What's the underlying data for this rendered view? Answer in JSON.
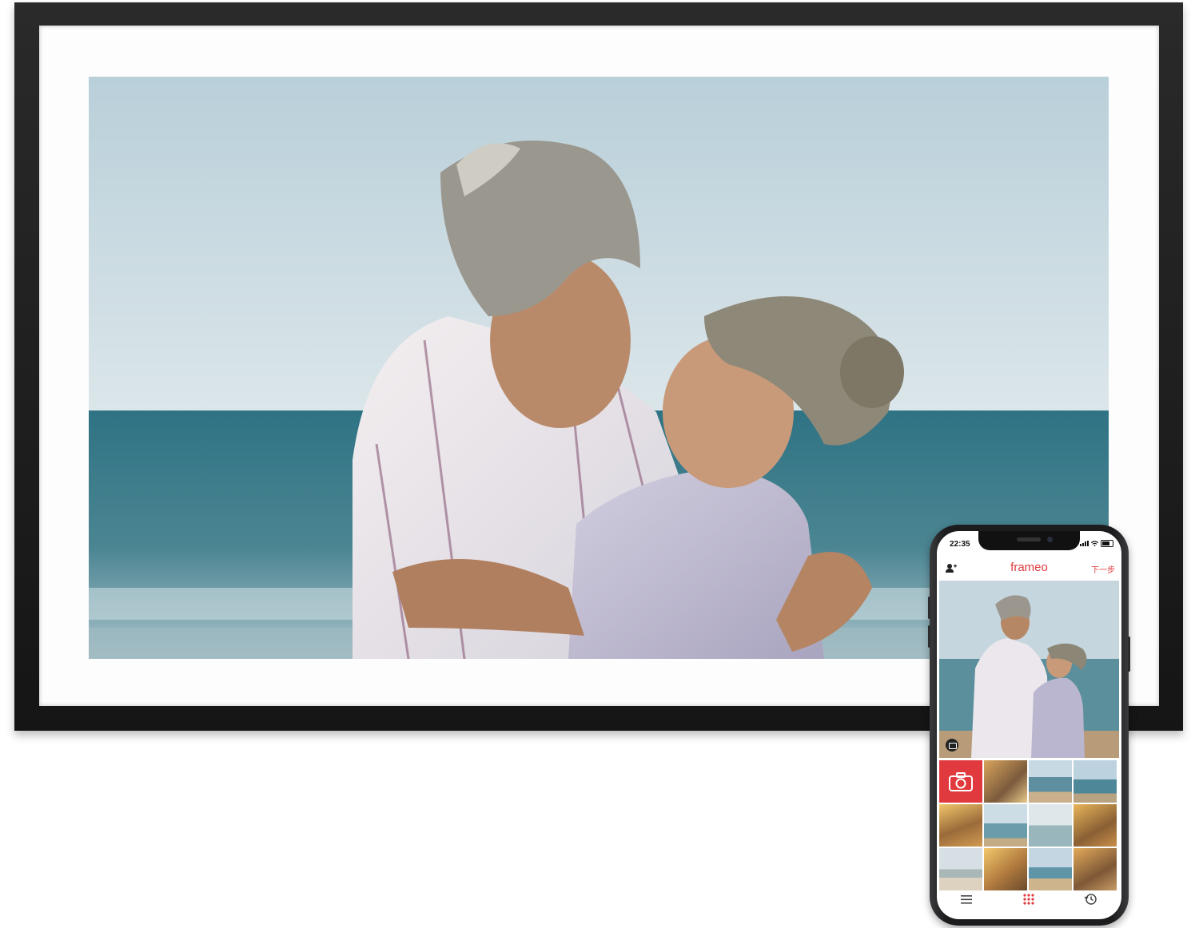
{
  "app": {
    "name": "frameo",
    "next_label": "下一步",
    "accent": "#e03a3e"
  },
  "status_bar": {
    "time": "22:35"
  },
  "icons": {
    "add_friend": "add-friend-icon",
    "camera": "camera-icon",
    "album": "album-icon",
    "menu": "menu-icon",
    "gallery": "gallery-grid-icon",
    "history": "history-icon"
  },
  "gallery": {
    "thumbnail_count": 11
  },
  "colors": {
    "frame": "#1c1c1c",
    "mat": "#fdfdfd",
    "sky": "#c9dbe6",
    "sea": "#3f7f8e"
  }
}
